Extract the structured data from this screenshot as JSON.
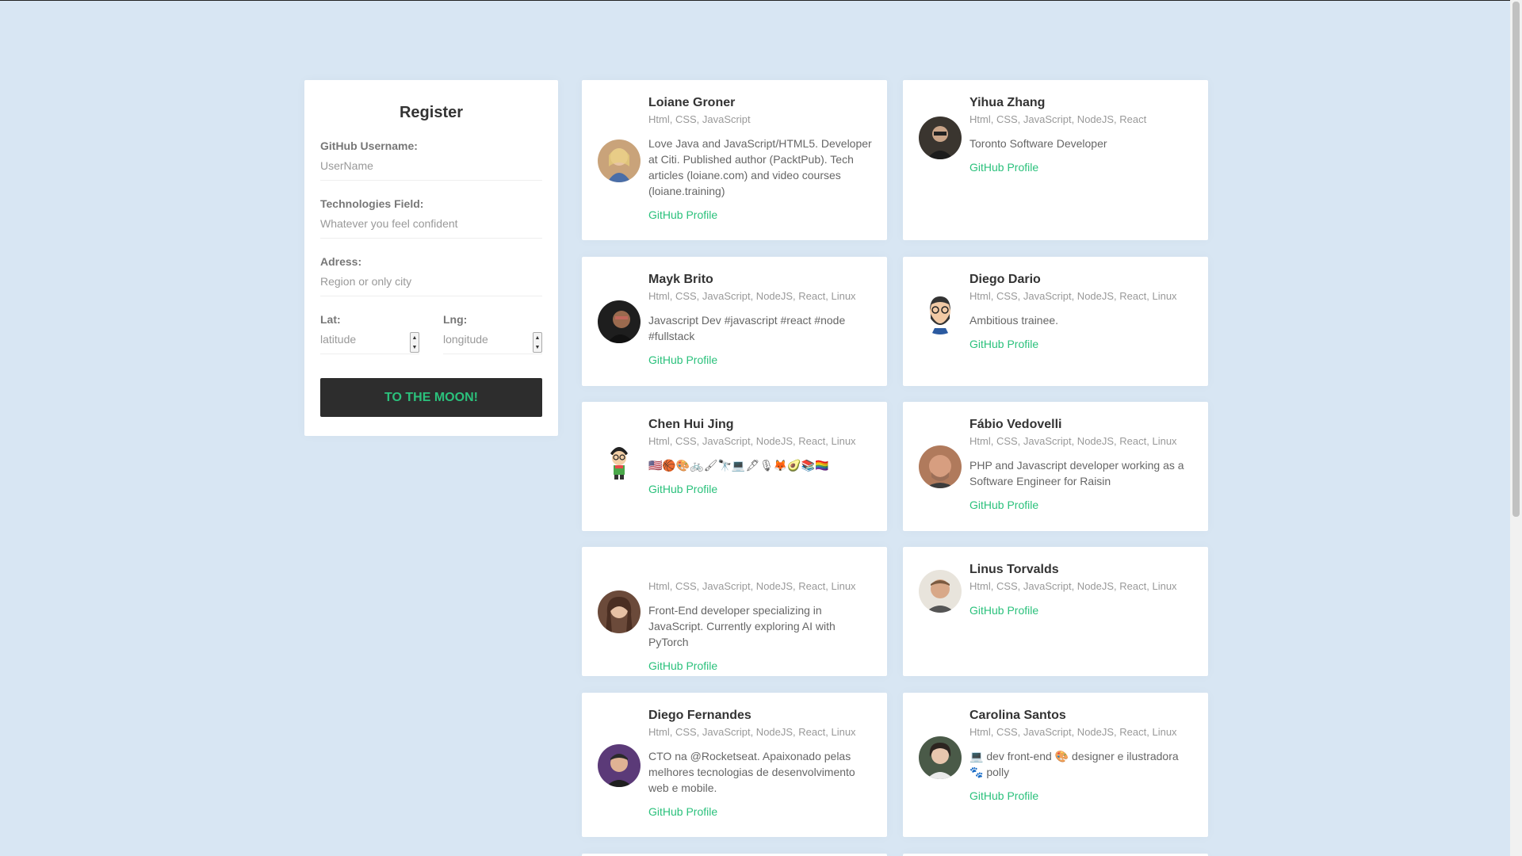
{
  "register": {
    "title": "Register",
    "username_label": "GitHub Username:",
    "username_placeholder": "UserName",
    "techs_label": "Technologies Field:",
    "techs_placeholder": "Whatever you feel confident",
    "address_label": "Adress:",
    "address_placeholder": "Region or only city",
    "lat_label": "Lat:",
    "lat_placeholder": "latitude",
    "lng_label": "Lng:",
    "lng_placeholder": "longitude",
    "submit_label": "TO THE MOON!"
  },
  "devs": [
    {
      "name": "Loiane Groner",
      "techs": "Html, CSS, JavaScript",
      "bio": "Love Java and JavaScript/HTML5. Developer at Citi. Published author (PacktPub). Tech articles (loiane.com) and video courses (loiane.training)",
      "link": "GitHub Profile",
      "avatar_color": "#c9a37a"
    },
    {
      "name": "Yihua Zhang",
      "techs": "Html, CSS, JavaScript, NodeJS, React",
      "bio": "Toronto Software Developer",
      "link": "GitHub Profile",
      "avatar_color": "#3a352f"
    },
    {
      "name": "Mayk Brito",
      "techs": "Html, CSS, JavaScript, NodeJS, React, Linux",
      "bio": "Javascript Dev #javascript #react #node #fullstack",
      "link": "GitHub Profile",
      "avatar_color": "#1e1e1e"
    },
    {
      "name": "Diego Dario",
      "techs": "Html, CSS, JavaScript, NodeJS, React, Linux",
      "bio": "Ambitious trainee.",
      "link": "GitHub Profile",
      "avatar_color": "#ffffff"
    },
    {
      "name": "Chen Hui Jing",
      "techs": "Html, CSS, JavaScript, NodeJS, React, Linux",
      "bio": "🇺🇸🏀🎨🚲🖌🔭💻🖋🎙🦊🥑📚🏳️‍🌈",
      "link": "GitHub Profile",
      "avatar_color": "#ffffff"
    },
    {
      "name": "Fábio Vedovelli",
      "techs": "Html, CSS, JavaScript, NodeJS, React, Linux",
      "bio": "PHP and Javascript developer working as a Software Engineer for Raisin",
      "link": "GitHub Profile",
      "avatar_color": "#b07a5c"
    },
    {
      "name": "",
      "techs": "Html, CSS, JavaScript, NodeJS, React, Linux",
      "bio": "Front-End developer specializing in JavaScript. Currently exploring AI with PyTorch",
      "link": "GitHub Profile",
      "avatar_color": "#6b4a3a"
    },
    {
      "name": "Linus Torvalds",
      "techs": "Html, CSS, JavaScript, NodeJS, React, Linux",
      "bio": "",
      "link": "GitHub Profile",
      "avatar_color": "#8a7560"
    },
    {
      "name": "Diego Fernandes",
      "techs": "Html, CSS, JavaScript, NodeJS, React, Linux",
      "bio": "CTO na @Rocketseat. Apaixonado pelas melhores tecnologias de desenvolvimento web e mobile.",
      "link": "GitHub Profile",
      "avatar_color": "#5b3a78"
    },
    {
      "name": "Carolina Santos",
      "techs": "Html, CSS, JavaScript, NodeJS, React, Linux",
      "bio": "💻 dev front-end 🎨 designer e ilustradora 🐾 polly",
      "link": "GitHub Profile",
      "avatar_color": "#4a5a48"
    }
  ]
}
